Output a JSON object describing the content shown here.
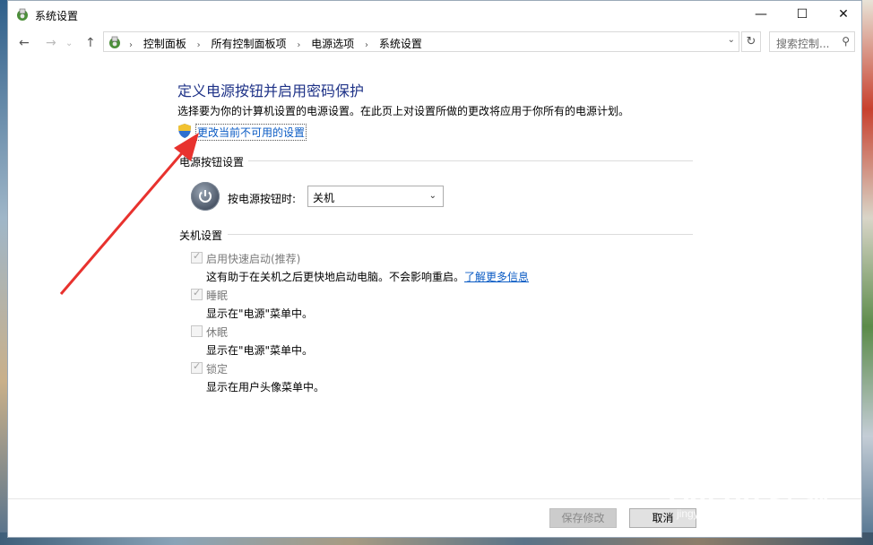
{
  "window": {
    "title": "系统设置",
    "minimize": "—",
    "maximize": "☐",
    "close": "✕"
  },
  "nav": {
    "back": "←",
    "forward": "→",
    "up": "↑"
  },
  "breadcrumbs": [
    "控制面板",
    "所有控制面板项",
    "电源选项",
    "系统设置"
  ],
  "search": {
    "placeholder": "搜索控制..."
  },
  "main": {
    "heading": "定义电源按钮并启用密码保护",
    "description": "选择要为你的计算机设置的电源设置。在此页上对设置所做的更改将应用于你所有的电源计划。",
    "change_link": "更改当前不可用的设置"
  },
  "power_section": {
    "label": "电源按钮设置",
    "power_button_label": "按电源按钮时:",
    "power_button_value": "关机"
  },
  "shutdown_section": {
    "label": "关机设置",
    "items": [
      {
        "label": "启用快速启动(推荐)",
        "desc": "这有助于在关机之后更快地启动电脑。不会影响重启。",
        "link": "了解更多信息",
        "checked": true
      },
      {
        "label": "睡眠",
        "desc": "显示在\"电源\"菜单中。",
        "checked": true
      },
      {
        "label": "休眠",
        "desc": "显示在\"电源\"菜单中。",
        "checked": false
      },
      {
        "label": "锁定",
        "desc": "显示在用户头像菜单中。",
        "checked": true
      }
    ]
  },
  "buttons": {
    "save": "保存修改",
    "cancel": "取消"
  },
  "watermark": {
    "text": "Bai du 经验",
    "sub": "jingyan.baidu.com"
  },
  "colors": {
    "heading": "#1e3287",
    "link": "#0a5bc4",
    "annotation_arrow": "#e8322e"
  }
}
